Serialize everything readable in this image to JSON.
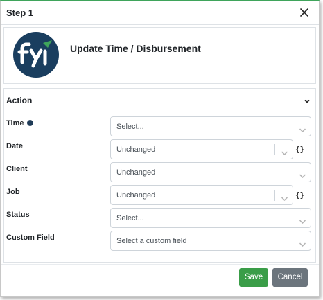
{
  "header": {
    "title": "Step 1"
  },
  "hero": {
    "title": "Update Time / Disbursement",
    "logo_icon": "fyi-logo",
    "brand_color": "#1a3e5f",
    "accent_color": "#3fa45b"
  },
  "section": {
    "title": "Action"
  },
  "fields": {
    "time": {
      "label": "Time",
      "value": "Select..."
    },
    "date": {
      "label": "Date",
      "value": "Unchanged"
    },
    "client": {
      "label": "Client",
      "value": "Unchanged"
    },
    "job": {
      "label": "Job",
      "value": "Unchanged"
    },
    "status": {
      "label": "Status",
      "value": "Select..."
    },
    "custom_field": {
      "label": "Custom Field",
      "value": "Select a custom field"
    }
  },
  "expression_button": "{}",
  "footer": {
    "save_label": "Save",
    "cancel_label": "Cancel",
    "save_color": "#3a9d48",
    "cancel_color": "#6c757d"
  }
}
